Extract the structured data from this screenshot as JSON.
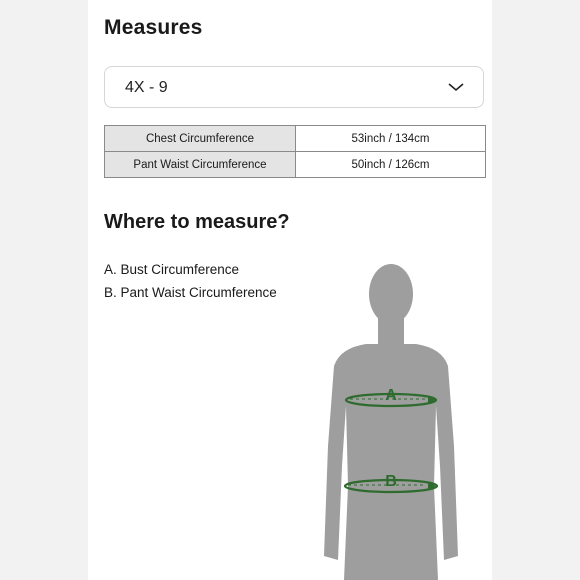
{
  "title": "Measures",
  "size_select": {
    "value": "4X - 9"
  },
  "table": {
    "rows": [
      {
        "label": "Chest Circumference",
        "value": "53inch / 134cm"
      },
      {
        "label": "Pant Waist Circumference",
        "value": "50inch / 126cm"
      }
    ]
  },
  "where_title": "Where to measure?",
  "instructions": [
    "A. Bust Circumference",
    "B. Pant Waist Circumference"
  ],
  "figure": {
    "marker_a": "A",
    "marker_b": "B",
    "colors": {
      "silhouette": "#9e9e9e",
      "marker": "#2f6b2f"
    }
  }
}
